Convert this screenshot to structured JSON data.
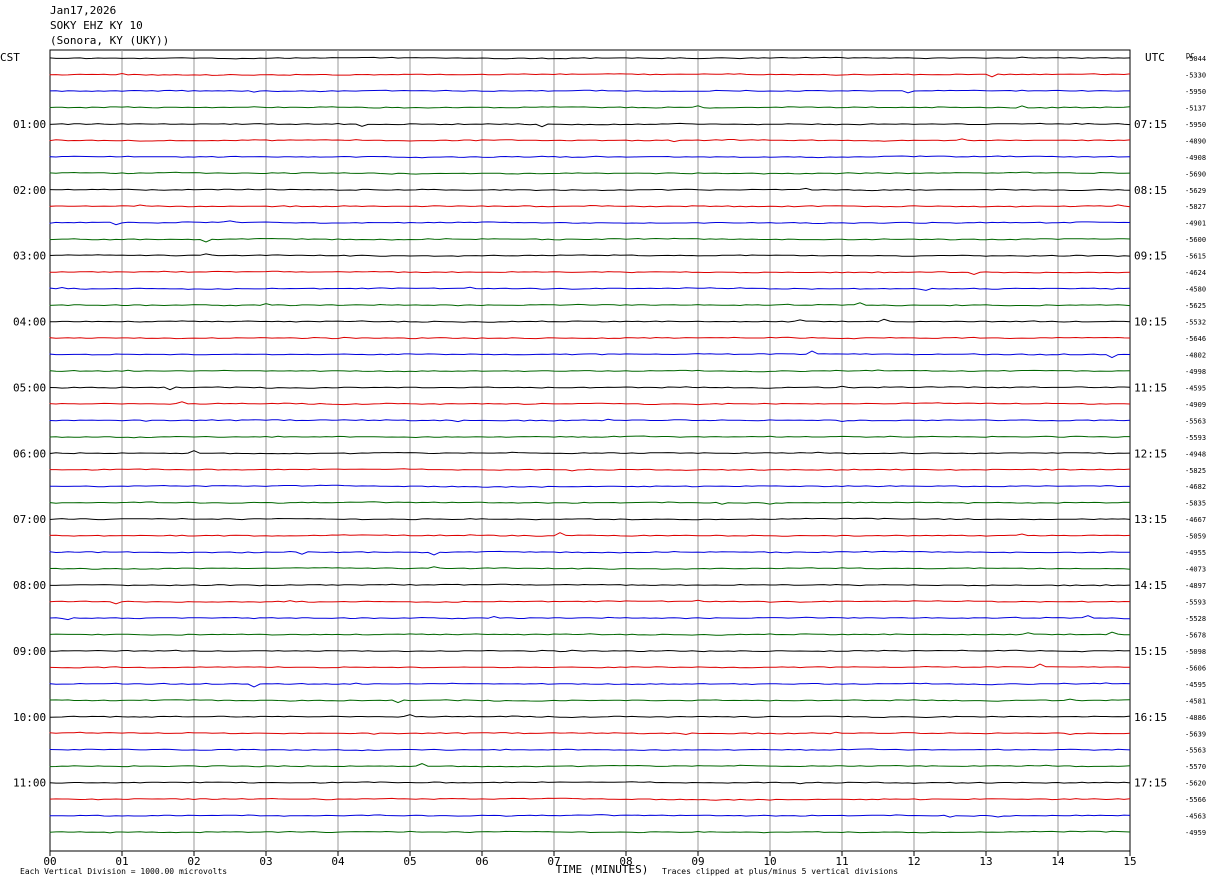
{
  "header": {
    "date": "Jan17,2026",
    "station": "SOKY EHZ KY 10",
    "location": "(Sonora, KY (UKY))"
  },
  "chart_data": {
    "type": "line",
    "title": "",
    "left_axis_label": "CST",
    "right_axis_label": "UTC",
    "dc_label": "DC",
    "xlabel": "TIME (MINUTES)",
    "x_ticks": [
      "00",
      "01",
      "02",
      "03",
      "04",
      "05",
      "06",
      "07",
      "08",
      "09",
      "10",
      "11",
      "12",
      "13",
      "14",
      "15"
    ],
    "xlim": [
      0,
      15
    ],
    "cst_labels": [
      "01:00",
      "02:00",
      "03:00",
      "04:00",
      "05:00",
      "06:00",
      "07:00",
      "08:00",
      "09:00",
      "10:00",
      "11:00"
    ],
    "utc_labels": [
      "07:15",
      "08:15",
      "09:15",
      "10:15",
      "11:15",
      "12:15",
      "13:15",
      "14:15",
      "15:15",
      "16:15",
      "17:15"
    ],
    "trace_colors": [
      "#000000",
      "#dd0000",
      "#0000dd",
      "#006600"
    ],
    "dc_offsets": [
      "-5044",
      "-5330",
      "-5950",
      "-5137",
      "-5950",
      "-4890",
      "-4908",
      "-5690",
      "-5629",
      "-5827",
      "-4901",
      "-5600",
      "-5615",
      "-4624",
      "-4580",
      "-5625",
      "-5532",
      "-5646",
      "-4802",
      "-4998",
      "-4595",
      "-4909",
      "-5563",
      "-5593",
      "-4948",
      "-5825",
      "-4682",
      "-5835",
      "-4667",
      "-5059",
      "-4955",
      "-4073",
      "-4897",
      "-5593",
      "-5528",
      "-5678",
      "-5098",
      "-5606",
      "-4595",
      "-4581",
      "-4886",
      "-5639",
      "-5563",
      "-5570",
      "-5620",
      "-5566",
      "-4563",
      "-4959"
    ],
    "footer_left": "Each Vertical Division = 1000.00 microvolts",
    "footer_right": "Traces clipped at plus/minus 5 vertical divisions"
  }
}
